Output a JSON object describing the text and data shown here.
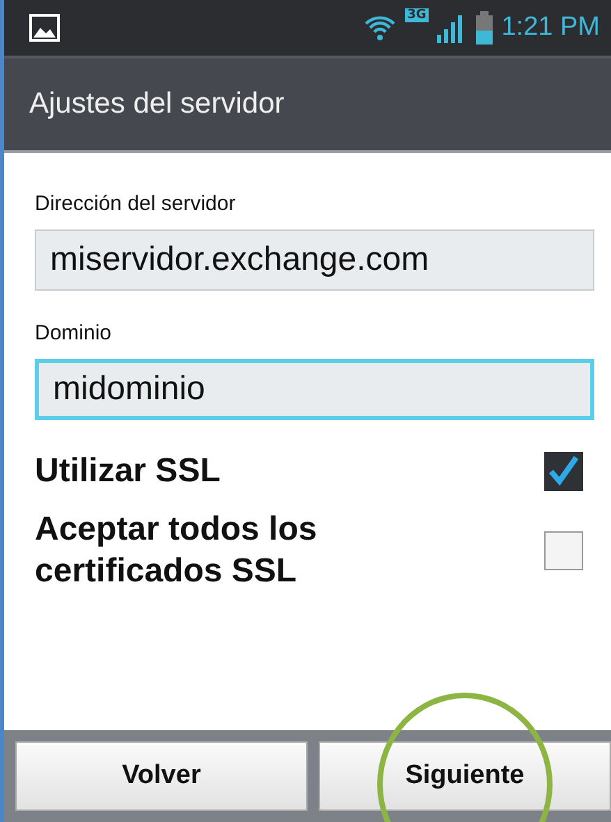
{
  "status_bar": {
    "network": "3G",
    "time": "1:21 PM"
  },
  "title": "Ajustes del servidor",
  "fields": [
    {
      "label": "Dirección del servidor",
      "value": "miservidor.exchange.com",
      "focused": false
    },
    {
      "label": "Dominio",
      "value": "midominio",
      "focused": true
    }
  ],
  "options": [
    {
      "label": "Utilizar SSL",
      "checked": true
    },
    {
      "label": "Aceptar todos los certificados SSL",
      "checked": false
    }
  ],
  "buttons": [
    {
      "label": "Volver",
      "highlighted": false
    },
    {
      "label": "Siguiente",
      "highlighted": true
    }
  ]
}
